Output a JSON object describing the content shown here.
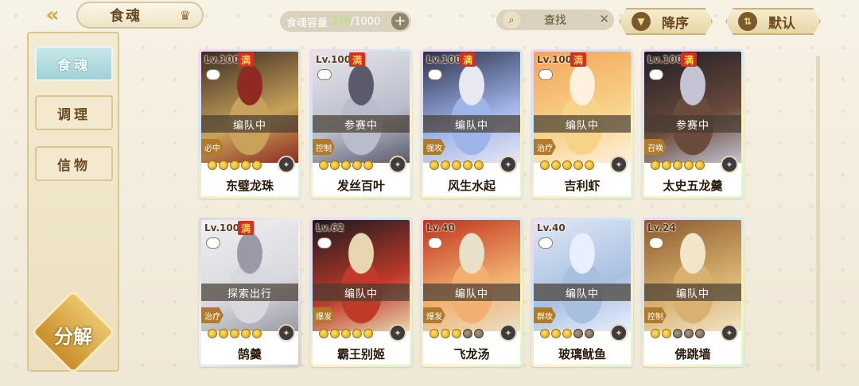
{
  "header": {
    "title": "食魂",
    "capacity_label": "食魂容量",
    "capacity_current": "376",
    "capacity_max": "/1000",
    "search_placeholder": "查找",
    "sort_order": "降序",
    "sort_mode": "默认"
  },
  "sidebar": {
    "tabs": [
      {
        "label": "食魂",
        "active": true
      },
      {
        "label": "调理",
        "active": false
      },
      {
        "label": "信物",
        "active": false
      }
    ],
    "decompose_label": "分解"
  },
  "cards": [
    {
      "level": "Lv.100",
      "maxed": "满",
      "status": "编队中",
      "role": "必中",
      "name": "东璧龙珠",
      "stars_lit": 5,
      "stars_total": 5,
      "portrait_colors": [
        "#3a2a22",
        "#c8a25a",
        "#8e2a22"
      ],
      "frame": "rainbow"
    },
    {
      "level": "Lv.100",
      "maxed": "满",
      "status": "参赛中",
      "role": "控制",
      "name": "发丝百叶",
      "stars_lit": 5,
      "stars_total": 5,
      "portrait_colors": [
        "#e6e6ea",
        "#b9bccb",
        "#5a5a6a"
      ],
      "frame": "rainbow"
    },
    {
      "level": "Lv.100",
      "maxed": "满",
      "status": "编队中",
      "role": "强攻",
      "name": "风生水起",
      "stars_lit": 5,
      "stars_total": 5,
      "portrait_colors": [
        "#2b2f4a",
        "#9fb4e8",
        "#e8e8f2"
      ],
      "frame": "rainbow"
    },
    {
      "level": "Lv.100",
      "maxed": "满",
      "status": "编队中",
      "role": "治疗",
      "name": "吉利虾",
      "stars_lit": 5,
      "stars_total": 5,
      "portrait_colors": [
        "#f4a35a",
        "#f7d38a",
        "#fff0e0"
      ],
      "frame": "rainbow"
    },
    {
      "level": "Lv.100",
      "maxed": "满",
      "status": "参赛中",
      "role": "召唤",
      "name": "太史五龙羹",
      "stars_lit": 5,
      "stars_total": 5,
      "portrait_colors": [
        "#1e1e28",
        "#6a4a3a",
        "#c4c4d4"
      ],
      "frame": "rainbow"
    },
    {
      "level": "Lv.100",
      "maxed": "满",
      "status": "探索出行",
      "role": "治疗",
      "name": "鹄羹",
      "stars_lit": 5,
      "stars_total": 5,
      "portrait_colors": [
        "#f0f0f2",
        "#d8d8de",
        "#9a9aa6"
      ],
      "frame": "grey"
    },
    {
      "level": "Lv.62",
      "maxed": "",
      "status": "编队中",
      "role": "爆发",
      "name": "霸王别姬",
      "stars_lit": 5,
      "stars_total": 5,
      "portrait_colors": [
        "#1a1a1e",
        "#c03a2a",
        "#e8d6b0"
      ],
      "frame": "rainbow"
    },
    {
      "level": "Lv.40",
      "maxed": "",
      "status": "编队中",
      "role": "爆发",
      "name": "飞龙汤",
      "stars_lit": 3,
      "stars_total": 5,
      "portrait_colors": [
        "#c0301a",
        "#f2b070",
        "#e8e0c8"
      ],
      "frame": "rainbow"
    },
    {
      "level": "Lv.40",
      "maxed": "",
      "status": "编队中",
      "role": "群攻",
      "name": "玻璃鱿鱼",
      "stars_lit": 3,
      "stars_total": 5,
      "portrait_colors": [
        "#dfe8f5",
        "#a8c0e0",
        "#e8f0ff"
      ],
      "frame": "rainbow"
    },
    {
      "level": "Lv.24",
      "maxed": "",
      "status": "编队中",
      "role": "控制",
      "name": "佛跳墙",
      "stars_lit": 2,
      "stars_total": 5,
      "portrait_colors": [
        "#8a5a2a",
        "#d8b070",
        "#f2e6c8"
      ],
      "frame": "rainbow"
    }
  ],
  "icons": {
    "back": "double-chevron-left-icon",
    "title_badge": "crown-icon",
    "search": "magnifier-icon",
    "clear": "close-icon",
    "sort_order": "triangle-down-icon",
    "sort_mode": "sort-arrows-icon",
    "element": "element-badge-icon"
  }
}
